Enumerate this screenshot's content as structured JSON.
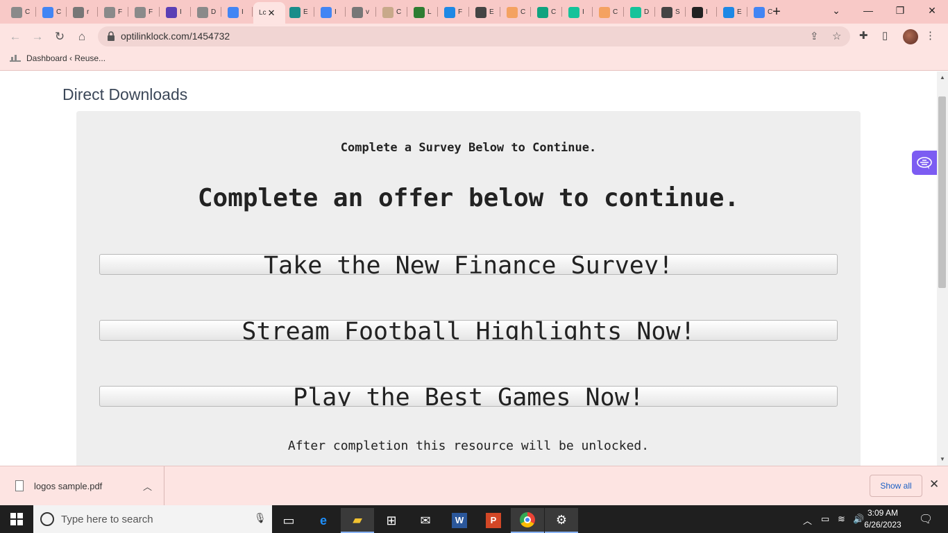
{
  "browser": {
    "tabs": [
      {
        "icon": "site-icon",
        "label": "C",
        "color": "#8a8a8a"
      },
      {
        "icon": "google-icon",
        "label": "C",
        "color": "#4285f4"
      },
      {
        "icon": "globe-icon",
        "label": "r",
        "color": "#777777"
      },
      {
        "icon": "site-icon",
        "label": "F",
        "color": "#8a8a8a"
      },
      {
        "icon": "site-icon",
        "label": "F",
        "color": "#8a8a8a"
      },
      {
        "icon": "ig-icon",
        "label": "I",
        "color": "#5b3fb5"
      },
      {
        "icon": "site-icon",
        "label": "D",
        "color": "#8a8a8a"
      },
      {
        "icon": "docs-icon",
        "label": "I",
        "color": "#4285f4"
      },
      {
        "icon": "",
        "label": "Lc",
        "color": "",
        "active": true
      },
      {
        "icon": "n-icon",
        "label": "E",
        "color": "#1a8d8a"
      },
      {
        "icon": "docs-icon",
        "label": "I",
        "color": "#4285f4"
      },
      {
        "icon": "globe-icon",
        "label": "v",
        "color": "#777777"
      },
      {
        "icon": "w-icon",
        "label": "C",
        "color": "#c8a98a"
      },
      {
        "icon": "download-icon",
        "label": "L",
        "color": "#2e7d32"
      },
      {
        "icon": "bird-icon",
        "label": "F",
        "color": "#1e88e5"
      },
      {
        "icon": "puzzle-icon",
        "label": "E",
        "color": "#444444"
      },
      {
        "icon": "chart-icon",
        "label": "C",
        "color": "#f4a261"
      },
      {
        "icon": "openai-icon",
        "label": "C",
        "color": "#10a37f"
      },
      {
        "icon": "grammarly-icon",
        "label": "I",
        "color": "#15c39a"
      },
      {
        "icon": "chart-icon",
        "label": "C",
        "color": "#f4a261"
      },
      {
        "icon": "grammarly-icon",
        "label": "D",
        "color": "#15c39a"
      },
      {
        "icon": "gear-icon",
        "label": "S",
        "color": "#444444"
      },
      {
        "icon": "github-icon",
        "label": "I",
        "color": "#222222"
      },
      {
        "icon": "bird-icon",
        "label": "E",
        "color": "#1e88e5"
      },
      {
        "icon": "docs-icon",
        "label": "C",
        "color": "#4285f4"
      }
    ],
    "url": "optilinklock.com/1454732",
    "bookmark": "Dashboard ‹ Reuse..."
  },
  "page": {
    "title": "Direct Downloads",
    "survey_line": "Complete a Survey Below to Continue.",
    "offer_heading": "Complete an offer below to continue.",
    "offers": [
      "Take the New Finance Survey!",
      "Stream Football Highlights Now!",
      "Play the Best Games Now!"
    ],
    "after_line": "After completion this resource will be unlocked."
  },
  "downloads": {
    "file_name": "logos sample.pdf",
    "show_all": "Show all"
  },
  "taskbar": {
    "search_placeholder": "Type here to search",
    "time": "3:09 AM",
    "date": "6/26/2023"
  },
  "colors": {
    "chrome_frame": "#f8c9c7",
    "chrome_toolbar": "#fde4e2",
    "panel": "#eeeeee",
    "accent_chip": "#7c5cf2"
  }
}
